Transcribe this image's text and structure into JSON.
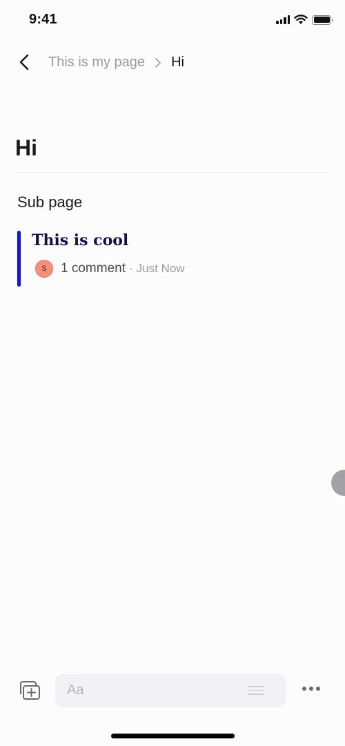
{
  "status_bar": {
    "time": "9:41",
    "icons": [
      "cellular-signal-icon",
      "wifi-icon",
      "battery-icon"
    ]
  },
  "nav": {
    "back_icon": "chevron-left-icon",
    "breadcrumb": {
      "parent": "This is my page",
      "separator_icon": "chevron-right-icon",
      "current": "Hi"
    }
  },
  "page": {
    "title": "Hi",
    "subpage_link": "Sub page"
  },
  "comment": {
    "text": "This is cool",
    "accent_color": "#1010e0",
    "avatar_initial": "S",
    "avatar_color": "#f4907a",
    "count_label": "1 comment",
    "separator": "·",
    "timestamp": "Just Now"
  },
  "toolbar": {
    "add_icon": "add-page-icon",
    "input_placeholder": "Aa",
    "input_icon": "text-lines-icon",
    "more_icon": "more-horizontal-icon"
  }
}
